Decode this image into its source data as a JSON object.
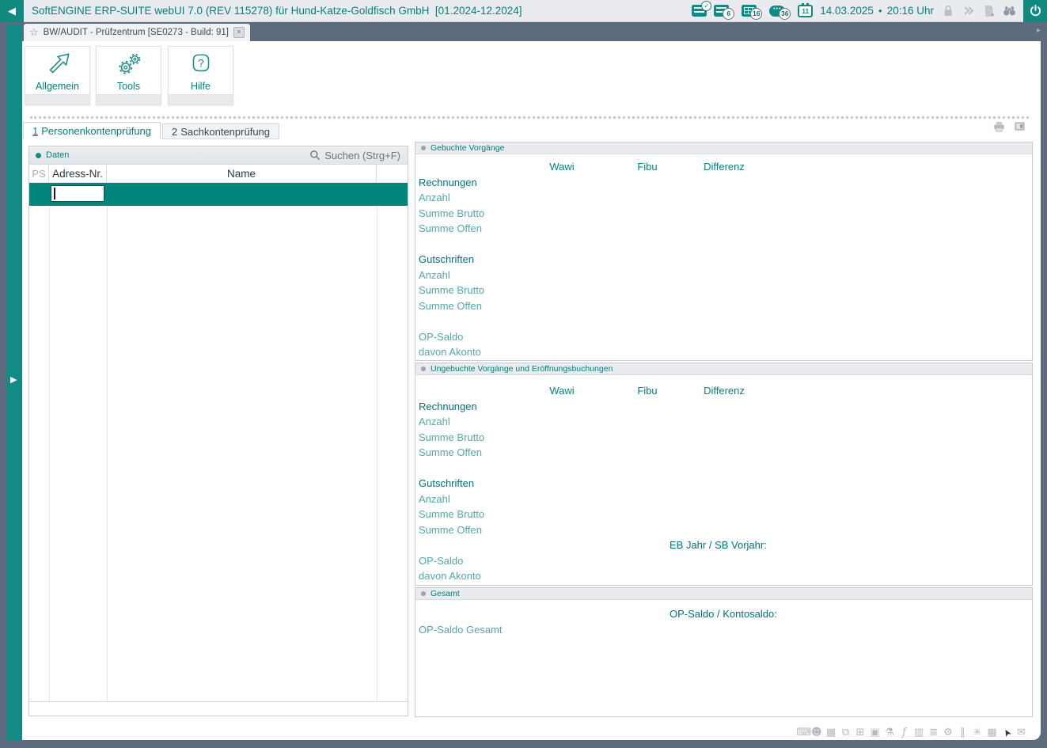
{
  "titlebar": {
    "title": "SoftENGINE ERP-SUITE webUI 7.0 (REV 115278) für Hund-Katze-Goldfisch GmbH  [01.2024-12.2024]",
    "badge_list": "6",
    "badge_grid": "16",
    "badge_chat": "36",
    "calendar_day": "11",
    "date": "14.03.2025",
    "time": "20:16 Uhr"
  },
  "icons": {
    "back": "◀",
    "chev_left": "◂",
    "chev_right": "▸",
    "expand": "▶",
    "star": "☆",
    "close": "×",
    "bullet": "●",
    "chat_dots": "•••",
    "check": "✓"
  },
  "window_tab": {
    "label": "BW/AUDIT - Prüfzentrum [SE0273 - Build: 91]"
  },
  "toolbar": {
    "buttons": [
      {
        "label": "Allgemein"
      },
      {
        "label": "Tools"
      },
      {
        "label": "Hilfe"
      }
    ]
  },
  "subtabs": [
    {
      "num": "1",
      "label": "Personenkontenprüfung"
    },
    {
      "num": "2",
      "label": "Sachkontenprüfung"
    }
  ],
  "left_panel": {
    "header": "Daten",
    "search_label": "Suchen (Strg+F)",
    "columns": [
      "PS",
      "Adress-Nr.",
      "Name"
    ],
    "input_value": ""
  },
  "sections": {
    "booked": {
      "title": "Gebuchte Vorgänge",
      "cols": [
        "Wawi",
        "Fibu",
        "Differenz"
      ],
      "rows": [
        "Rechnungen",
        "Anzahl",
        "Summe Brutto",
        "Summe Offen",
        "Gutschriften",
        "Anzahl",
        "Summe Brutto",
        "Summe Offen",
        "OP-Saldo",
        "davon Akonto"
      ]
    },
    "unbooked": {
      "title": "Ungebuchte Vorgänge und Eröffnungsbuchungen",
      "cols": [
        "Wawi",
        "Fibu",
        "Differenz"
      ],
      "note": "EB Jahr / SB Vorjahr:",
      "rows": [
        "Rechnungen",
        "Anzahl",
        "Summe Brutto",
        "Summe Offen",
        "Gutschriften",
        "Anzahl",
        "Summe Brutto",
        "Summe Offen",
        "OP-Saldo",
        "davon Akonto"
      ]
    },
    "total": {
      "title": "Gesamt",
      "note": "OP-Saldo / Kontosaldo:",
      "row": "OP-Saldo Gesamt"
    }
  },
  "status_icons": [
    {
      "name": "keyboard",
      "glyph": "⌨"
    },
    {
      "name": "user",
      "glyph": "☻"
    },
    {
      "name": "calculator",
      "glyph": "▦"
    },
    {
      "name": "copy",
      "glyph": "⧉"
    },
    {
      "name": "screen",
      "glyph": "⊞"
    },
    {
      "name": "lock",
      "glyph": "▣"
    },
    {
      "name": "flask",
      "glyph": "⚗"
    },
    {
      "name": "formula",
      "glyph": "ƒ"
    },
    {
      "name": "book",
      "glyph": "▥"
    },
    {
      "name": "report",
      "glyph": "≣"
    },
    {
      "name": "gears",
      "glyph": "⚙"
    },
    {
      "name": "columns",
      "glyph": "∥"
    },
    {
      "name": "snowflake",
      "glyph": "✳"
    },
    {
      "name": "calendar",
      "glyph": "▦"
    },
    {
      "name": "cursor",
      "glyph": "➤"
    },
    {
      "name": "message",
      "glyph": "✉"
    }
  ],
  "colors": {
    "accent": "#118b83",
    "selection": "#00857c",
    "frame": "#5c6b7e"
  }
}
